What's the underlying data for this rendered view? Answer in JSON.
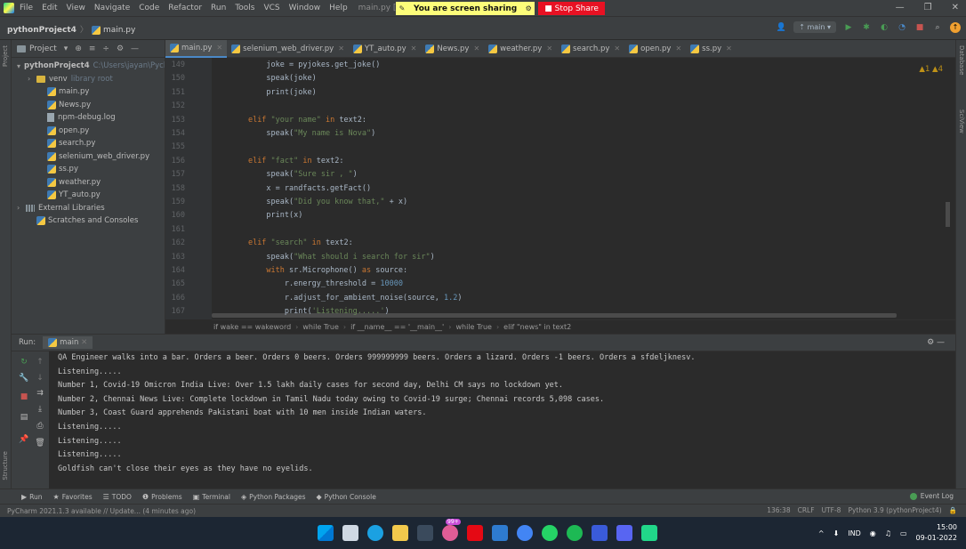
{
  "window": {
    "menu": [
      "File",
      "Edit",
      "View",
      "Navigate",
      "Code",
      "Refactor",
      "Run",
      "Tools",
      "VCS",
      "Window",
      "Help"
    ],
    "title_path": "main.py [C:\\Users\\jayan",
    "share_text": "You are screen sharing",
    "stop_share": "Stop Share"
  },
  "navbar": {
    "project": "pythonProject4",
    "file": "main.py",
    "branch": "main"
  },
  "project_panel": {
    "header": "Project",
    "tree": [
      {
        "label": "pythonProject4",
        "dim": "C:\\Users\\jayan\\Pych",
        "type": "folder",
        "indent": 0,
        "arrow": "v"
      },
      {
        "label": "venv",
        "dim": "library root",
        "type": "venv",
        "indent": 1,
        "arrow": ">"
      },
      {
        "label": "main.py",
        "type": "py",
        "indent": 2
      },
      {
        "label": "News.py",
        "type": "py",
        "indent": 2
      },
      {
        "label": "npm-debug.log",
        "type": "file",
        "indent": 2
      },
      {
        "label": "open.py",
        "type": "py",
        "indent": 2
      },
      {
        "label": "search.py",
        "type": "py",
        "indent": 2
      },
      {
        "label": "selenium_web_driver.py",
        "type": "py",
        "indent": 2
      },
      {
        "label": "ss.py",
        "type": "py",
        "indent": 2
      },
      {
        "label": "weather.py",
        "type": "py",
        "indent": 2
      },
      {
        "label": "YT_auto.py",
        "type": "py",
        "indent": 2
      },
      {
        "label": "External Libraries",
        "type": "lib",
        "indent": 0,
        "arrow": ">"
      },
      {
        "label": "Scratches and Consoles",
        "type": "scratch",
        "indent": 1
      }
    ]
  },
  "tabs": [
    "main.py",
    "selenium_web_driver.py",
    "YT_auto.py",
    "News.py",
    "weather.py",
    "search.py",
    "open.py",
    "ss.py"
  ],
  "editor": {
    "warnings": "▲1 ▲4",
    "line_numbers": [
      "149",
      "150",
      "151",
      "152",
      "153",
      "154",
      "155",
      "156",
      "157",
      "158",
      "159",
      "160",
      "161",
      "162",
      "163",
      "164",
      "165",
      "166",
      "167"
    ],
    "lines": [
      [
        {
          "t": "            joke = pyjokes.get_joke()",
          "c": ""
        }
      ],
      [
        {
          "t": "            speak(joke)",
          "c": ""
        }
      ],
      [
        {
          "t": "            print(joke)",
          "c": ""
        }
      ],
      [
        {
          "t": "",
          "c": ""
        }
      ],
      [
        {
          "t": "        ",
          "c": ""
        },
        {
          "t": "elif ",
          "c": "kw"
        },
        {
          "t": "\"your name\"",
          "c": "str"
        },
        {
          "t": " in ",
          "c": "kw"
        },
        {
          "t": "text2:",
          "c": ""
        }
      ],
      [
        {
          "t": "            speak(",
          "c": ""
        },
        {
          "t": "\"My name is Nova\"",
          "c": "str"
        },
        {
          "t": ")",
          "c": ""
        }
      ],
      [
        {
          "t": "",
          "c": ""
        }
      ],
      [
        {
          "t": "        ",
          "c": ""
        },
        {
          "t": "elif ",
          "c": "kw"
        },
        {
          "t": "\"fact\"",
          "c": "str"
        },
        {
          "t": " in ",
          "c": "kw"
        },
        {
          "t": "text2:",
          "c": ""
        }
      ],
      [
        {
          "t": "            speak(",
          "c": ""
        },
        {
          "t": "\"Sure sir , \"",
          "c": "str"
        },
        {
          "t": ")",
          "c": ""
        }
      ],
      [
        {
          "t": "            x = randfacts.getFact()",
          "c": ""
        }
      ],
      [
        {
          "t": "            speak(",
          "c": ""
        },
        {
          "t": "\"Did you know that,\"",
          "c": "str"
        },
        {
          "t": " + x)",
          "c": ""
        }
      ],
      [
        {
          "t": "            print(x)",
          "c": ""
        }
      ],
      [
        {
          "t": "",
          "c": ""
        }
      ],
      [
        {
          "t": "        ",
          "c": ""
        },
        {
          "t": "elif ",
          "c": "kw"
        },
        {
          "t": "\"search\"",
          "c": "str"
        },
        {
          "t": " in ",
          "c": "kw"
        },
        {
          "t": "text2:",
          "c": ""
        }
      ],
      [
        {
          "t": "            speak(",
          "c": ""
        },
        {
          "t": "\"What should i search for sir\"",
          "c": "str"
        },
        {
          "t": ")",
          "c": ""
        }
      ],
      [
        {
          "t": "            ",
          "c": ""
        },
        {
          "t": "with ",
          "c": "kw"
        },
        {
          "t": "sr.Microphone() ",
          "c": ""
        },
        {
          "t": "as ",
          "c": "kw"
        },
        {
          "t": "source:",
          "c": ""
        }
      ],
      [
        {
          "t": "                r.energy_threshold = ",
          "c": ""
        },
        {
          "t": "10000",
          "c": "num"
        }
      ],
      [
        {
          "t": "                r.adjust_for_ambient_noise(source, ",
          "c": ""
        },
        {
          "t": "1.2",
          "c": "num"
        },
        {
          "t": ")",
          "c": ""
        }
      ],
      [
        {
          "t": "                print(",
          "c": ""
        },
        {
          "t": "'Listening.....'",
          "c": "str"
        },
        {
          "t": ")",
          "c": ""
        }
      ]
    ]
  },
  "code_breadcrumbs": [
    "if wake == wakeword",
    "while True",
    "if __name__ == '__main__'",
    "while True",
    "elif \"news\" in text2"
  ],
  "run": {
    "label": "Run:",
    "tab": "main",
    "output": [
      "QA Engineer walks into a bar. Orders a beer. Orders 0 beers. Orders 999999999 beers. Orders a lizard. Orders -1 beers. Orders a sfdeljknesv.",
      "Listening.....",
      "Number 1, Covid-19 Omicron India Live: Over 1.5 lakh daily cases for second day, Delhi CM says no lockdown yet.",
      "Number 2, Chennai News Live: Complete lockdown in Tamil Nadu today owing to Covid-19 surge; Chennai records 5,098 cases.",
      "Number 3, Coast Guard apprehends Pakistani boat with 10 men inside Indian waters.",
      "Listening.....",
      "Listening.....",
      "Listening.....",
      "Goldfish can't close their eyes as they have no eyelids."
    ]
  },
  "bottom_tabs": [
    "Run",
    "Favorites",
    "TODO",
    "Problems",
    "Terminal",
    "Python Packages",
    "Python Console"
  ],
  "event_log": "Event Log",
  "status": {
    "message": "PyCharm 2021.1.3 available // Update... (4 minutes ago)",
    "position": "136:38",
    "line_sep": "CRLF",
    "encoding": "UTF-8",
    "interpreter": "Python 3.9 (pythonProject4)"
  },
  "side_labels": {
    "project": "Project",
    "structure": "Structure",
    "favorites": "Favorites",
    "database": "Database",
    "sciview": "SciView"
  },
  "taskbar": {
    "lang": "IND",
    "time": "15:00",
    "date": "09-01-2022",
    "badge": "99+"
  }
}
